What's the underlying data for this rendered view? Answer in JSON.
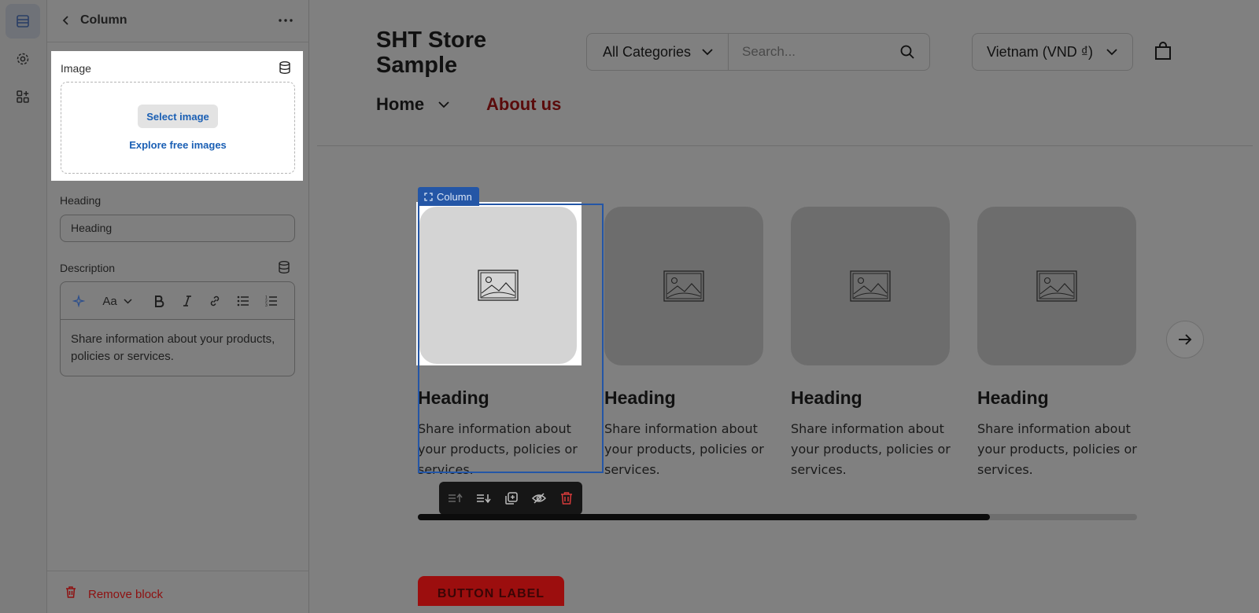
{
  "rail": {
    "items": [
      {
        "icon": "sections-icon",
        "active": true
      },
      {
        "icon": "gear-icon",
        "active": false
      },
      {
        "icon": "apps-icon",
        "active": false
      }
    ]
  },
  "panel": {
    "title": "Column",
    "image": {
      "label": "Image",
      "select_button": "Select image",
      "explore_link": "Explore free images"
    },
    "heading": {
      "label": "Heading",
      "value": "Heading"
    },
    "description": {
      "label": "Description",
      "body": "Share information about your products, policies or services.",
      "font_button": "Aa"
    },
    "remove_block": "Remove block"
  },
  "preview": {
    "store_name": "SHT Store Sample",
    "category_select": "All Categories",
    "search_placeholder": "Search...",
    "country_select": "Vietnam (VND ₫)",
    "nav": {
      "home": "Home",
      "about": "About us"
    },
    "column_tag": "Column",
    "cards": [
      {
        "heading": "Heading",
        "description": "Share information about your products, policies or services."
      },
      {
        "heading": "Heading",
        "description": "Share information about your products, policies or services."
      },
      {
        "heading": "Heading",
        "description": "Share information about your products, policies or services."
      },
      {
        "heading": "Heading",
        "description": "Share information about your products, policies or services."
      }
    ],
    "scroll_progress": 0.795,
    "cta_label": "BUTTON LABEL"
  },
  "colors": {
    "accent_blue": "#2456a6",
    "link_blue": "#1a5fb4",
    "danger_red": "#8e1010",
    "brand_red": "#9c0e0e"
  }
}
